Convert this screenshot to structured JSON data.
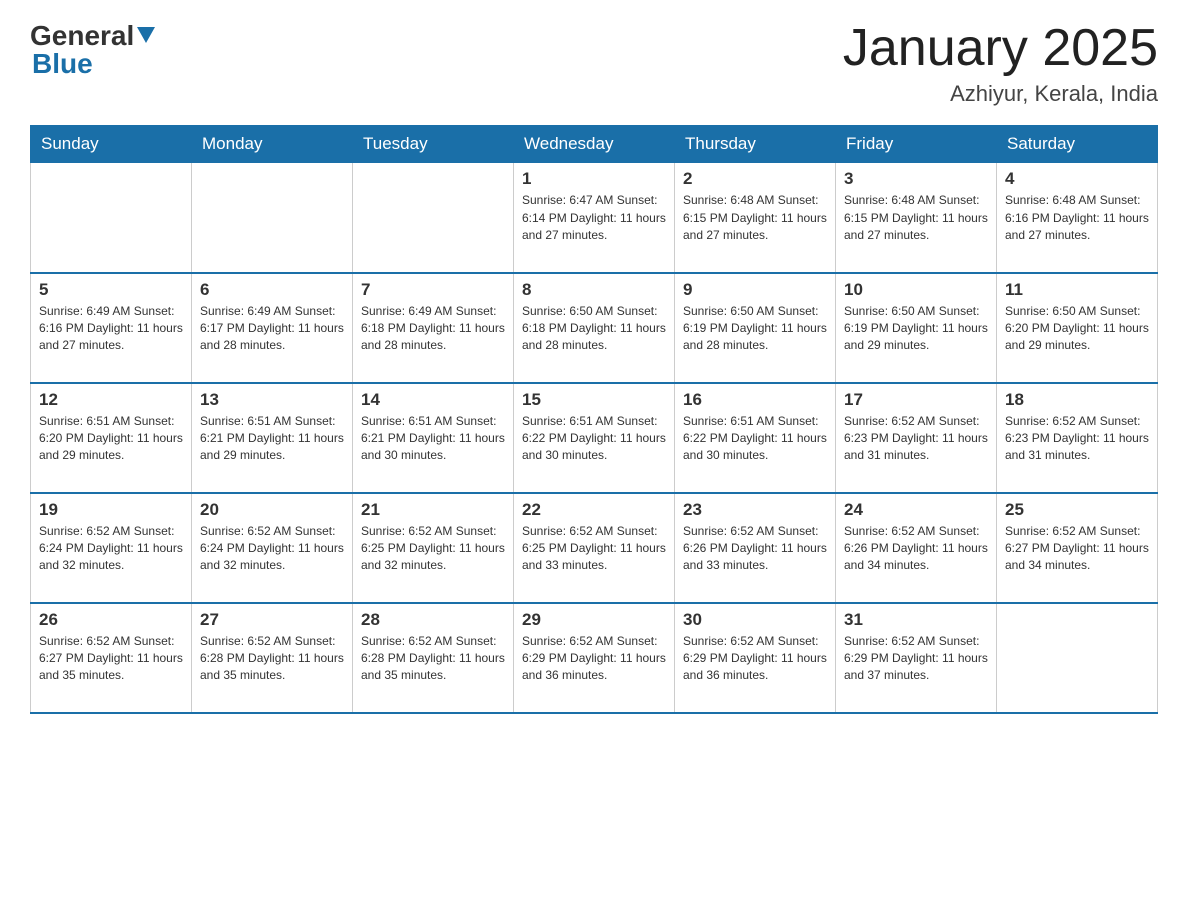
{
  "header": {
    "logo_general": "General",
    "logo_blue": "Blue",
    "month_title": "January 2025",
    "location": "Azhiyur, Kerala, India"
  },
  "weekdays": [
    "Sunday",
    "Monday",
    "Tuesday",
    "Wednesday",
    "Thursday",
    "Friday",
    "Saturday"
  ],
  "weeks": [
    [
      {
        "day": "",
        "info": ""
      },
      {
        "day": "",
        "info": ""
      },
      {
        "day": "",
        "info": ""
      },
      {
        "day": "1",
        "info": "Sunrise: 6:47 AM\nSunset: 6:14 PM\nDaylight: 11 hours and 27 minutes."
      },
      {
        "day": "2",
        "info": "Sunrise: 6:48 AM\nSunset: 6:15 PM\nDaylight: 11 hours and 27 minutes."
      },
      {
        "day": "3",
        "info": "Sunrise: 6:48 AM\nSunset: 6:15 PM\nDaylight: 11 hours and 27 minutes."
      },
      {
        "day": "4",
        "info": "Sunrise: 6:48 AM\nSunset: 6:16 PM\nDaylight: 11 hours and 27 minutes."
      }
    ],
    [
      {
        "day": "5",
        "info": "Sunrise: 6:49 AM\nSunset: 6:16 PM\nDaylight: 11 hours and 27 minutes."
      },
      {
        "day": "6",
        "info": "Sunrise: 6:49 AM\nSunset: 6:17 PM\nDaylight: 11 hours and 28 minutes."
      },
      {
        "day": "7",
        "info": "Sunrise: 6:49 AM\nSunset: 6:18 PM\nDaylight: 11 hours and 28 minutes."
      },
      {
        "day": "8",
        "info": "Sunrise: 6:50 AM\nSunset: 6:18 PM\nDaylight: 11 hours and 28 minutes."
      },
      {
        "day": "9",
        "info": "Sunrise: 6:50 AM\nSunset: 6:19 PM\nDaylight: 11 hours and 28 minutes."
      },
      {
        "day": "10",
        "info": "Sunrise: 6:50 AM\nSunset: 6:19 PM\nDaylight: 11 hours and 29 minutes."
      },
      {
        "day": "11",
        "info": "Sunrise: 6:50 AM\nSunset: 6:20 PM\nDaylight: 11 hours and 29 minutes."
      }
    ],
    [
      {
        "day": "12",
        "info": "Sunrise: 6:51 AM\nSunset: 6:20 PM\nDaylight: 11 hours and 29 minutes."
      },
      {
        "day": "13",
        "info": "Sunrise: 6:51 AM\nSunset: 6:21 PM\nDaylight: 11 hours and 29 minutes."
      },
      {
        "day": "14",
        "info": "Sunrise: 6:51 AM\nSunset: 6:21 PM\nDaylight: 11 hours and 30 minutes."
      },
      {
        "day": "15",
        "info": "Sunrise: 6:51 AM\nSunset: 6:22 PM\nDaylight: 11 hours and 30 minutes."
      },
      {
        "day": "16",
        "info": "Sunrise: 6:51 AM\nSunset: 6:22 PM\nDaylight: 11 hours and 30 minutes."
      },
      {
        "day": "17",
        "info": "Sunrise: 6:52 AM\nSunset: 6:23 PM\nDaylight: 11 hours and 31 minutes."
      },
      {
        "day": "18",
        "info": "Sunrise: 6:52 AM\nSunset: 6:23 PM\nDaylight: 11 hours and 31 minutes."
      }
    ],
    [
      {
        "day": "19",
        "info": "Sunrise: 6:52 AM\nSunset: 6:24 PM\nDaylight: 11 hours and 32 minutes."
      },
      {
        "day": "20",
        "info": "Sunrise: 6:52 AM\nSunset: 6:24 PM\nDaylight: 11 hours and 32 minutes."
      },
      {
        "day": "21",
        "info": "Sunrise: 6:52 AM\nSunset: 6:25 PM\nDaylight: 11 hours and 32 minutes."
      },
      {
        "day": "22",
        "info": "Sunrise: 6:52 AM\nSunset: 6:25 PM\nDaylight: 11 hours and 33 minutes."
      },
      {
        "day": "23",
        "info": "Sunrise: 6:52 AM\nSunset: 6:26 PM\nDaylight: 11 hours and 33 minutes."
      },
      {
        "day": "24",
        "info": "Sunrise: 6:52 AM\nSunset: 6:26 PM\nDaylight: 11 hours and 34 minutes."
      },
      {
        "day": "25",
        "info": "Sunrise: 6:52 AM\nSunset: 6:27 PM\nDaylight: 11 hours and 34 minutes."
      }
    ],
    [
      {
        "day": "26",
        "info": "Sunrise: 6:52 AM\nSunset: 6:27 PM\nDaylight: 11 hours and 35 minutes."
      },
      {
        "day": "27",
        "info": "Sunrise: 6:52 AM\nSunset: 6:28 PM\nDaylight: 11 hours and 35 minutes."
      },
      {
        "day": "28",
        "info": "Sunrise: 6:52 AM\nSunset: 6:28 PM\nDaylight: 11 hours and 35 minutes."
      },
      {
        "day": "29",
        "info": "Sunrise: 6:52 AM\nSunset: 6:29 PM\nDaylight: 11 hours and 36 minutes."
      },
      {
        "day": "30",
        "info": "Sunrise: 6:52 AM\nSunset: 6:29 PM\nDaylight: 11 hours and 36 minutes."
      },
      {
        "day": "31",
        "info": "Sunrise: 6:52 AM\nSunset: 6:29 PM\nDaylight: 11 hours and 37 minutes."
      },
      {
        "day": "",
        "info": ""
      }
    ]
  ]
}
